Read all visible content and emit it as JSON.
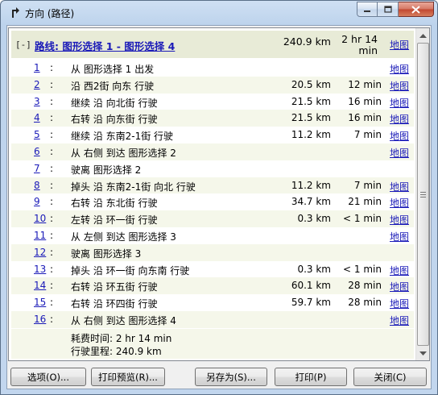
{
  "window": {
    "title": "方向 (路径)"
  },
  "route": {
    "toggle": "[-]",
    "title": "路线: 图形选择  1 - 图形选择  4",
    "distance": "240.9 km",
    "time_line1": "2 hr 14",
    "time_line2": "min",
    "map_link": "地图"
  },
  "steps": [
    {
      "num": "1",
      "text": "从  图形选择  1 出发",
      "distance": "",
      "time": "",
      "map": "地图"
    },
    {
      "num": "2",
      "text": "沿  西2街  向东  行驶",
      "distance": "20.5 km",
      "time": "12 min",
      "map": "地图"
    },
    {
      "num": "3",
      "text": "继续  沿  向北街  行驶",
      "distance": "21.5 km",
      "time": "16 min",
      "map": "地图"
    },
    {
      "num": "4",
      "text": "右转  沿  向东街  行驶",
      "distance": "21.5 km",
      "time": "16 min",
      "map": "地图"
    },
    {
      "num": "5",
      "text": "继续  沿  东南2-1街  行驶",
      "distance": "11.2 km",
      "time": "7 min",
      "map": "地图"
    },
    {
      "num": "6",
      "text": "从  右侧  到达  图形选择  2",
      "distance": "",
      "time": "",
      "map": "地图"
    },
    {
      "num": "7",
      "text": "驶离  图形选择  2",
      "distance": "",
      "time": "",
      "map": ""
    },
    {
      "num": "8",
      "text": "掉头  沿  东南2-1街  向北  行驶",
      "distance": "11.2 km",
      "time": "7 min",
      "map": "地图"
    },
    {
      "num": "9",
      "text": "右转  沿  东北街  行驶",
      "distance": "34.7 km",
      "time": "21 min",
      "map": "地图"
    },
    {
      "num": "10",
      "text": "左转  沿  环一街  行驶",
      "distance": "0.3 km",
      "time": "< 1 min",
      "map": "地图"
    },
    {
      "num": "11",
      "text": "从  左侧  到达  图形选择  3",
      "distance": "",
      "time": "",
      "map": "地图"
    },
    {
      "num": "12",
      "text": "驶离  图形选择  3",
      "distance": "",
      "time": "",
      "map": ""
    },
    {
      "num": "13",
      "text": "掉头  沿  环一街  向东南  行驶",
      "distance": "0.3 km",
      "time": "< 1 min",
      "map": "地图"
    },
    {
      "num": "14",
      "text": "右转  沿  环五街  行驶",
      "distance": "60.1 km",
      "time": "28 min",
      "map": "地图"
    },
    {
      "num": "15",
      "text": "右转  沿  环四街  行驶",
      "distance": "59.7 km",
      "time": "28 min",
      "map": "地图"
    },
    {
      "num": "16",
      "text": "从  右侧  到达  图形选择  4",
      "distance": "",
      "time": "",
      "map": "地图"
    }
  ],
  "summary": {
    "time": "耗费时间: 2 hr 14 min",
    "distance": "行驶里程: 240.9 km"
  },
  "buttons": {
    "options": "选项(O)...",
    "print_preview": "打印预览(R)...",
    "save_as": "另存为(S)...",
    "print": "打印(P)",
    "close": "关闭(C)"
  },
  "colors": {
    "link": "#1a1ab8",
    "header_bg": "#e8ebd7",
    "alt_row_bg": "#f5f7ea"
  }
}
